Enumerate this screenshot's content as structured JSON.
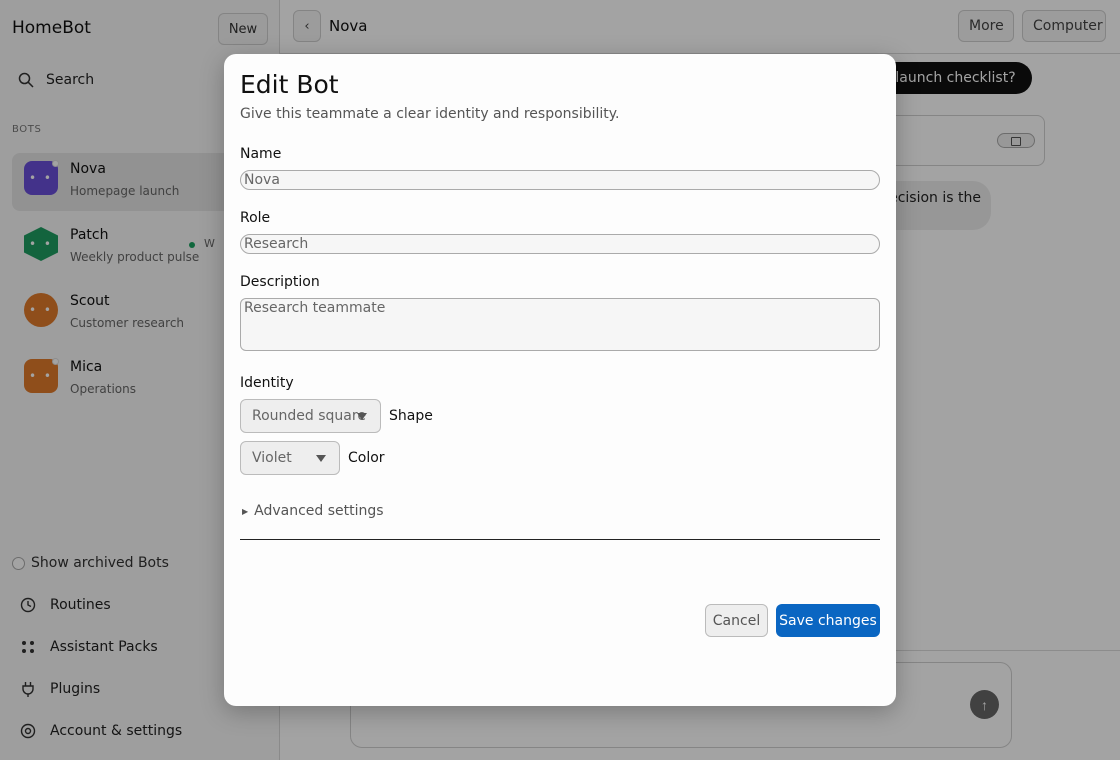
{
  "sidebar": {
    "app_title": "HomeBot",
    "new_label": "New",
    "search_label": "Search",
    "section_label": "BOTS",
    "bots": [
      {
        "name": "Nova",
        "subtitle": "Homepage launch",
        "color": "#6a4fd8",
        "shape": "rounded-square",
        "face": "• •"
      },
      {
        "name": "Patch",
        "subtitle": "Weekly product pulse",
        "color": "#1f9d62",
        "shape": "hexagon",
        "face": "• •",
        "status_text": "W"
      },
      {
        "name": "Scout",
        "subtitle": "Customer research",
        "color": "#e07a2b",
        "shape": "circle",
        "face": "• •"
      },
      {
        "name": "Mica",
        "subtitle": "Operations",
        "color": "#e07a2b",
        "shape": "rounded-square",
        "face": "• •"
      }
    ],
    "archived_label": "Show archived Bots",
    "nav": [
      {
        "label": "Routines",
        "icon": "clock-icon"
      },
      {
        "label": "Assistant Packs",
        "icon": "grid-icon"
      },
      {
        "label": "Plugins",
        "icon": "plug-icon"
      },
      {
        "label": "Account & settings",
        "icon": "settings-icon"
      }
    ]
  },
  "main": {
    "back_label": "‹",
    "title": "Nova",
    "more_label": "More",
    "computer_label": "Computer",
    "user_message": "page launch checklist?",
    "reply_text": "ecision is the",
    "send_icon": "↑"
  },
  "modal": {
    "title": "Edit Bot",
    "subtitle": "Give this teammate a clear identity and responsibility.",
    "name_label": "Name",
    "name_value": "Nova",
    "role_label": "Role",
    "role_value": "Research",
    "description_label": "Description",
    "description_value": "Research teammate",
    "identity_label": "Identity",
    "shape_value": "Rounded square",
    "shape_label": "Shape",
    "color_value": "Violet",
    "color_label": "Color",
    "advanced_label": "Advanced settings",
    "cancel_label": "Cancel",
    "save_label": "Save changes",
    "accent_color": "#0a66c2"
  }
}
